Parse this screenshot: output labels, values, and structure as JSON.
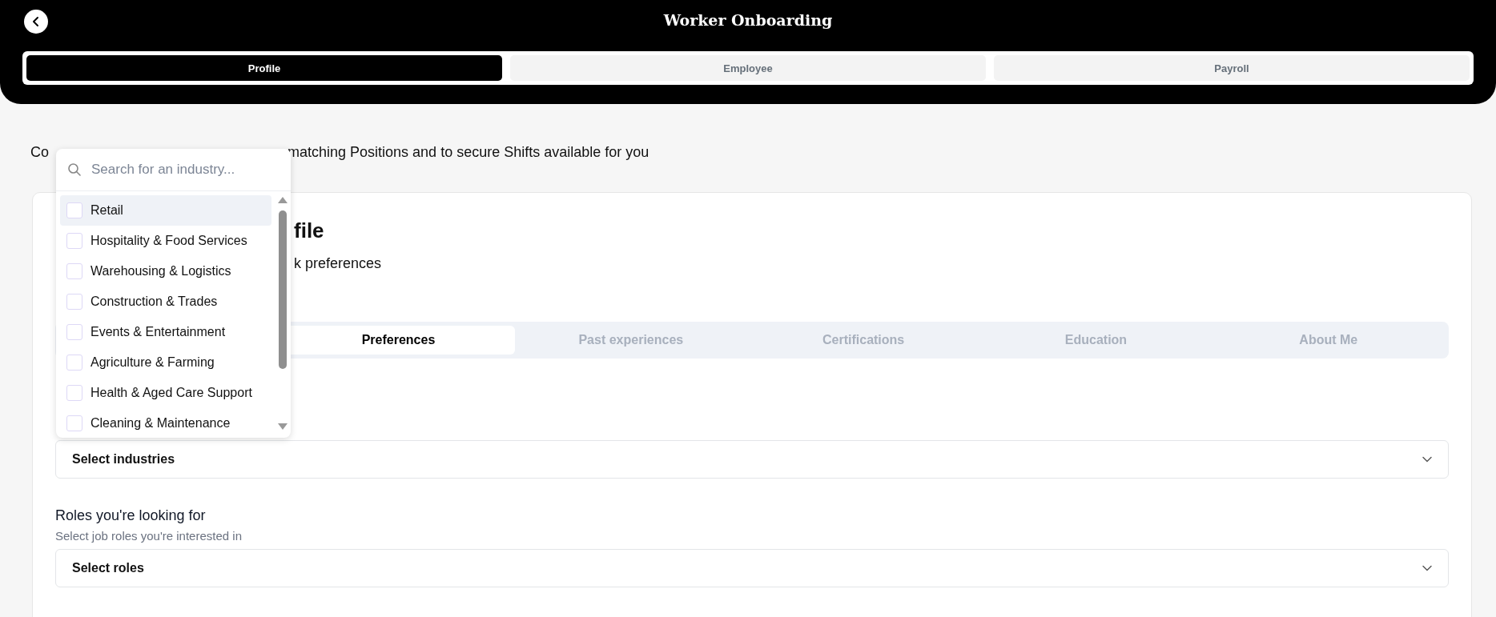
{
  "header": {
    "title": "Worker Onboarding",
    "steps": [
      {
        "label": "Profile",
        "selected": true
      },
      {
        "label": "Employee",
        "selected": false
      },
      {
        "label": "Payroll",
        "selected": false
      }
    ]
  },
  "intro": {
    "visible_start": "Co",
    "visible_end": "matching Positions and to secure Shifts available for you"
  },
  "card": {
    "title_visible": "file",
    "subtitle_visible": "k preferences",
    "tabs": [
      {
        "label": "Preferences",
        "selected": true
      },
      {
        "label": "Past experiences",
        "selected": false
      },
      {
        "label": "Certifications",
        "selected": false
      },
      {
        "label": "Education",
        "selected": false
      },
      {
        "label": "About Me",
        "selected": false
      }
    ],
    "fields": [
      {
        "kind": "select",
        "placeholder": "Select industries"
      },
      {
        "kind": "labelled-select",
        "label": "Roles you're looking for",
        "hint": "Select job roles you're interested in",
        "placeholder": "Select roles"
      }
    ]
  },
  "dropdown": {
    "search": {
      "placeholder": "Search for an industry..."
    },
    "options": [
      {
        "label": "Retail",
        "checked": false,
        "highlighted": true
      },
      {
        "label": "Hospitality & Food Services",
        "checked": false,
        "highlighted": false
      },
      {
        "label": "Warehousing & Logistics",
        "checked": false,
        "highlighted": false
      },
      {
        "label": "Construction & Trades",
        "checked": false,
        "highlighted": false
      },
      {
        "label": "Events & Entertainment",
        "checked": false,
        "highlighted": false
      },
      {
        "label": "Agriculture & Farming",
        "checked": false,
        "highlighted": false
      },
      {
        "label": "Health & Aged Care Support",
        "checked": false,
        "highlighted": false
      },
      {
        "label": "Cleaning & Maintenance",
        "checked": false,
        "highlighted": false
      }
    ]
  }
}
